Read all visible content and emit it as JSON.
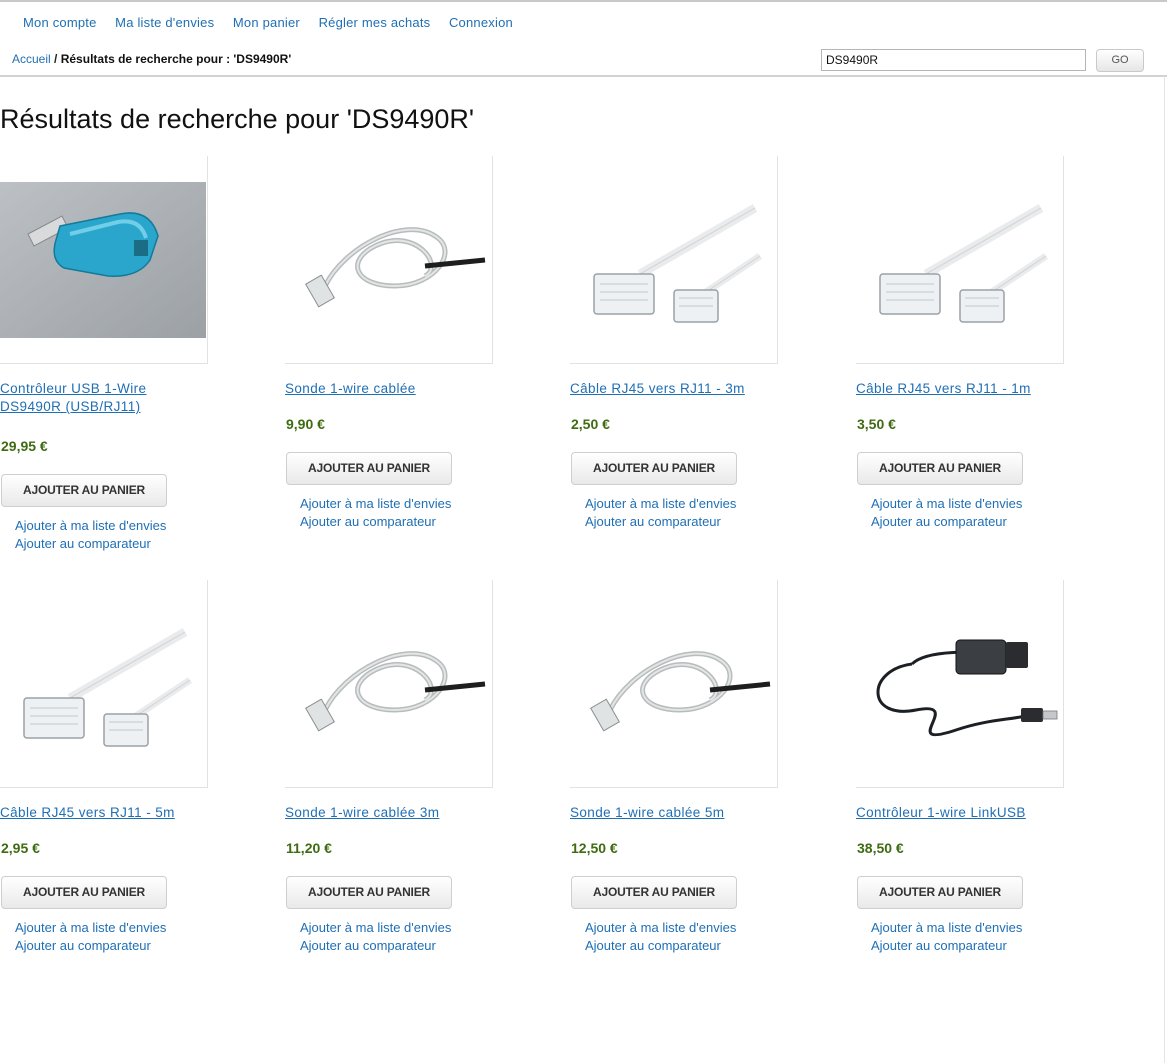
{
  "nav": {
    "items": [
      "Mon compte",
      "Ma liste d'envies",
      "Mon panier",
      "Régler mes achats",
      "Connexion"
    ]
  },
  "breadcrumb": {
    "home": "Accueil",
    "separator": "/",
    "current": "Résultats de recherche pour : 'DS9490R'"
  },
  "search": {
    "value": "DS9490R",
    "button": "GO"
  },
  "page_title": "Résultats de recherche pour 'DS9490R'",
  "actions": {
    "add_to_cart": "AJOUTER AU PANIER",
    "wishlist": "Ajouter à ma liste d'envies",
    "compare": "Ajouter au comparateur"
  },
  "products": [
    {
      "name": "Contrôleur USB 1-Wire DS9490R (USB/RJ11)",
      "price": "29,95 €",
      "image": "usb-adapter"
    },
    {
      "name": "Sonde 1-wire cablée",
      "price": "9,90 €",
      "image": "cable-probe"
    },
    {
      "name": "Câble RJ45 vers RJ11 - 3m",
      "price": "2,50 €",
      "image": "rj45-rj11-cable"
    },
    {
      "name": "Câble RJ45 vers RJ11 - 1m",
      "price": "3,50 €",
      "image": "rj45-rj11-cable"
    },
    {
      "name": "Câble RJ45 vers RJ11 - 5m",
      "price": "2,95 €",
      "image": "rj45-rj11-cable"
    },
    {
      "name": "Sonde 1-wire cablée 3m",
      "price": "11,20 €",
      "image": "cable-probe"
    },
    {
      "name": "Sonde 1-wire cablée 5m",
      "price": "12,50 €",
      "image": "cable-probe"
    },
    {
      "name": "Contrôleur 1-wire LinkUSB",
      "price": "38,50 €",
      "image": "linkusb"
    }
  ],
  "colors": {
    "link": "#1f6fb5",
    "price": "#3f6b12"
  }
}
